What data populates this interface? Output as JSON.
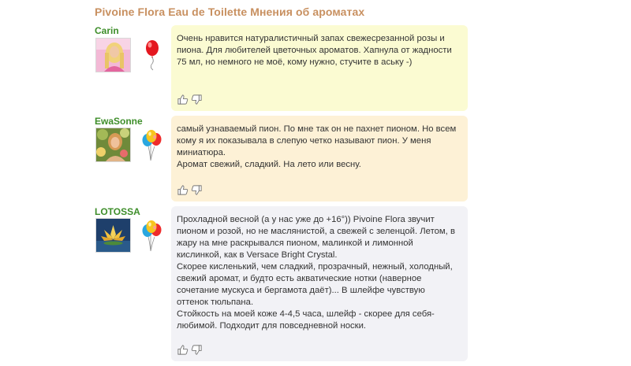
{
  "page": {
    "title": "Pivoine Flora Eau de Toilette Мнения об ароматах"
  },
  "colors": {
    "title": "#c89060",
    "username": "#3e8e2a",
    "card_yellow": "#fbfbd2",
    "card_orange": "#fdf1d6",
    "card_gray": "#f2f2f6"
  },
  "reviews": [
    {
      "username": "Carin",
      "balloon_icon": "single-red-balloon-icon",
      "card_color": "#fbfbd2",
      "text": [
        "Очень нравится натуралистичный запах свежесрезанной розы и пиона. Для любителей цветочных ароматов. Хапнула от жадности 75 мл, но немного не моё, кому нужно, стучите в аську -)"
      ]
    },
    {
      "username": "EwaSonne",
      "balloon_icon": "balloon-bunch-icon",
      "card_color": "#fdf1d6",
      "text": [
        "самый узнаваемый пион. По мне так он не пахнет пионом. Но всем кому я их показывала в слепую четко называют пион. У меня миниатюра.",
        "Аромат свежий, сладкий. На лето или весну."
      ]
    },
    {
      "username": "LOTOSSA",
      "balloon_icon": "balloon-bunch-icon",
      "card_color": "#f2f2f6",
      "text": [
        "Прохладной весной (а у нас уже до +16°)) Pivoine Flora звучит пионом и розой, но не маслянистой, а свежей с зеленцой. Летом, в жару на мне раскрывался пионом, малинкой и лимонной кислинкой, как в Versace Bright Crystal.",
        "Скорее кисленький, чем сладкий, прозрачный, нежный, холодный, свежий аромат, и будто есть акватические нотки (наверное сочетание мускуса и бергамота даёт)... В шлейфе чувствую оттенок тюльпана.",
        "Стойкость на моей коже 4-4,5 часа, шлейф - скорее для себя-любимой. Подходит для повседневной носки."
      ]
    }
  ]
}
